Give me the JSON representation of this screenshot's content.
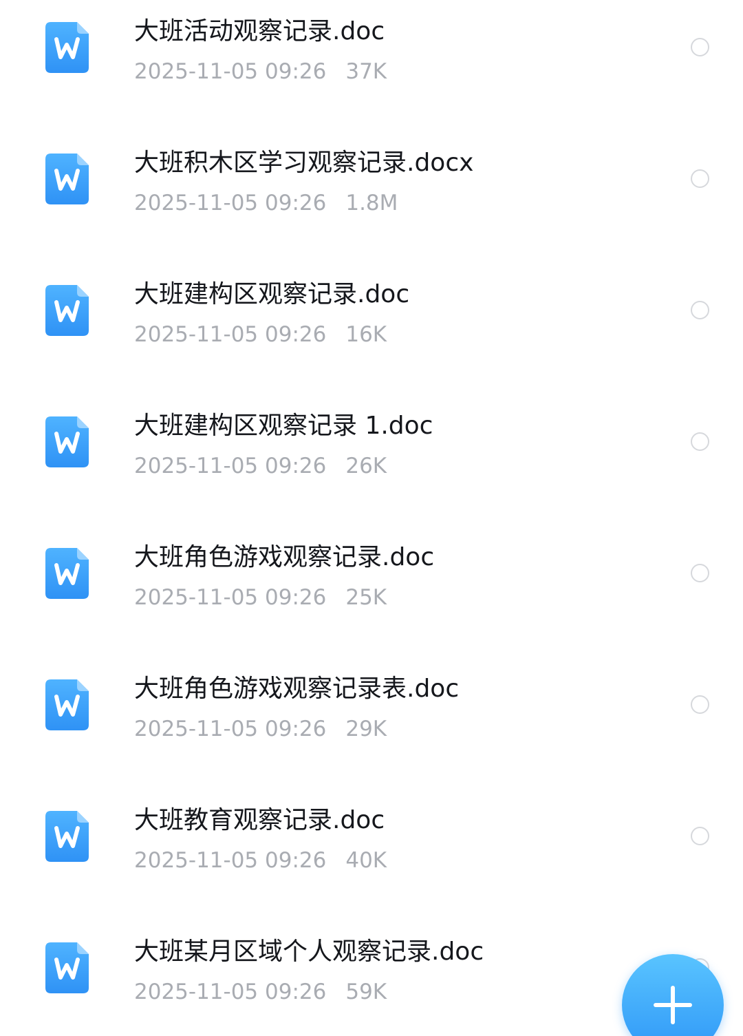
{
  "accent_color": "#2f97f7",
  "file_icon": "word-doc-icon",
  "files": [
    {
      "name": "大班活动观察记录.doc",
      "date": "2025-11-05 09:26",
      "size": "37K"
    },
    {
      "name": "大班积木区学习观察记录.docx",
      "date": "2025-11-05 09:26",
      "size": "1.8M"
    },
    {
      "name": "大班建构区观察记录.doc",
      "date": "2025-11-05 09:26",
      "size": "16K"
    },
    {
      "name": "大班建构区观察记录 1.doc",
      "date": "2025-11-05 09:26",
      "size": "26K"
    },
    {
      "name": "大班角色游戏观察记录.doc",
      "date": "2025-11-05 09:26",
      "size": "25K"
    },
    {
      "name": "大班角色游戏观察记录表.doc",
      "date": "2025-11-05 09:26",
      "size": "29K"
    },
    {
      "name": "大班教育观察记录.doc",
      "date": "2025-11-05 09:26",
      "size": "40K"
    },
    {
      "name": "大班某月区域个人观察记录.doc",
      "date": "2025-11-05 09:26",
      "size": "59K"
    }
  ],
  "fab": {
    "icon": "plus-icon"
  }
}
